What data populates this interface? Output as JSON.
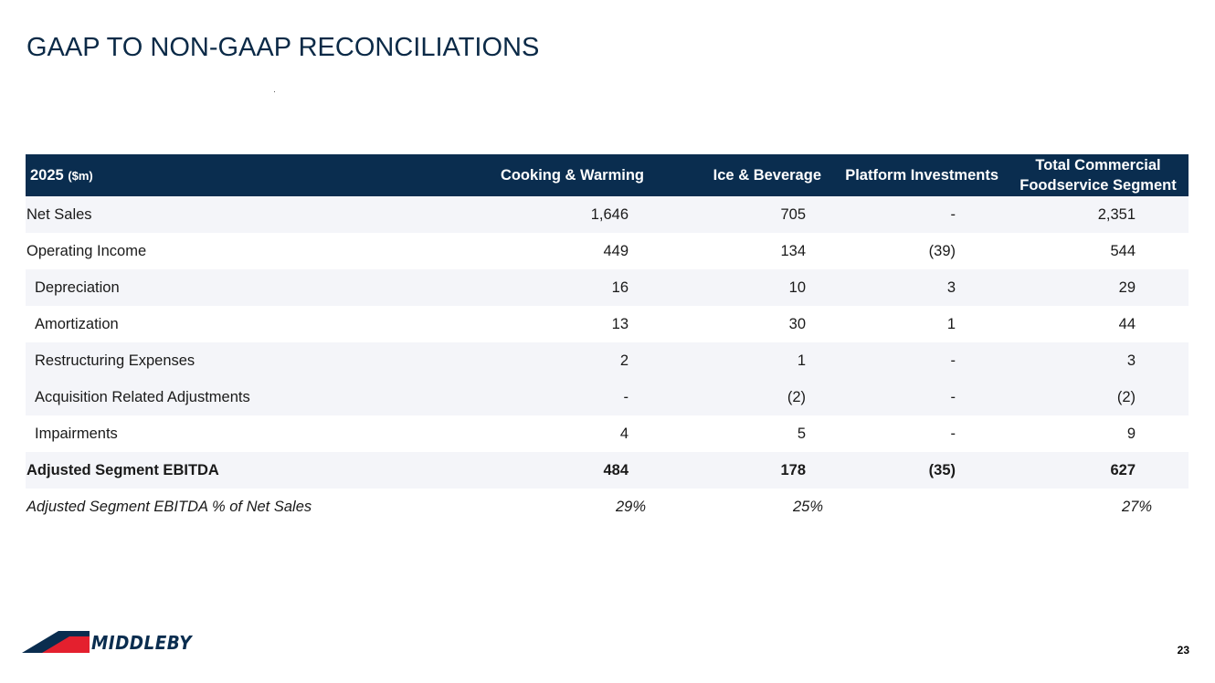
{
  "title": "GAAP TO NON-GAAP RECONCILIATIONS",
  "table": {
    "header": {
      "year_label": "2025",
      "unit_label": "($m)",
      "columns": [
        "Cooking & Warming",
        "Ice & Beverage",
        "Platform Investments"
      ],
      "total_line1": "Total Commercial",
      "total_line2": "Foodservice Segment"
    },
    "rows": [
      {
        "label": "Net Sales",
        "values": [
          "1,646",
          "705",
          "-",
          "2,351"
        ]
      },
      {
        "label": "Operating Income",
        "values": [
          "449",
          "134",
          "(39)",
          "544"
        ]
      },
      {
        "label": "Depreciation",
        "values": [
          "16",
          "10",
          "3",
          "29"
        ]
      },
      {
        "label": "Amortization",
        "values": [
          "13",
          "30",
          "1",
          "44"
        ]
      },
      {
        "label": "Restructuring Expenses",
        "values": [
          "2",
          "1",
          "-",
          "3"
        ]
      },
      {
        "label": "Acquisition Related Adjustments",
        "values": [
          "-",
          "(2)",
          "-",
          "(2)"
        ]
      },
      {
        "label": "Impairments",
        "values": [
          "4",
          "5",
          "-",
          "9"
        ]
      },
      {
        "label": "Adjusted Segment EBITDA",
        "values": [
          "484",
          "178",
          "(35)",
          "627"
        ]
      },
      {
        "label": "Adjusted Segment EBITDA % of Net Sales",
        "values": [
          "29%",
          "25%",
          "",
          "27%"
        ]
      }
    ]
  },
  "logo": {
    "text": "MIDDLEBY",
    "colors": {
      "navy": "#0a2d4f",
      "red": "#e4202e"
    }
  },
  "page_number": "23",
  "colors": {
    "header_bg": "#0a2d4f",
    "row_shade": "#f4f5f9",
    "title": "#0b2a47"
  }
}
